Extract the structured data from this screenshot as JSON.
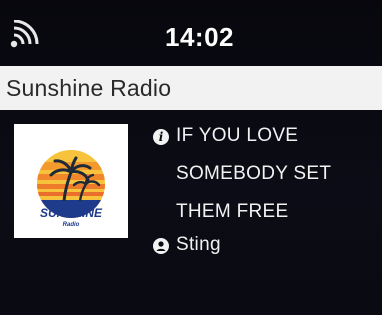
{
  "status": {
    "time": "14:02",
    "wifi_icon": "wifi-icon"
  },
  "station": {
    "name": "Sunshine Radio",
    "logo": {
      "title": "SUNSHINE",
      "subtitle": "Radio",
      "icon": "palm-sunset-logo"
    }
  },
  "now_playing": {
    "track_icon": "info-icon",
    "track_lines": [
      "IF YOU LOVE",
      "SOMEBODY SET",
      "THEM FREE"
    ],
    "artist_icon": "person-icon",
    "artist": "Sting"
  },
  "colors": {
    "background": "#0b0b12",
    "station_bar": "#f2f2f2",
    "text": "#f2f2f2",
    "logo_text": "#1e3a8a",
    "logo_sun": "#f5b731"
  }
}
